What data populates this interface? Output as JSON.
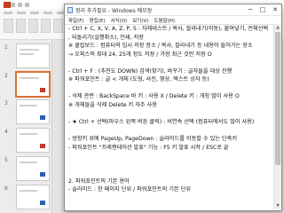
{
  "notepad": {
    "title": "정리 추가필요 - Windows 메모장",
    "menu": [
      "파일(F)",
      "편집(E)",
      "서식(O)",
      "보기(V)",
      "도움말(H)"
    ],
    "window_buttons": {
      "minimize": "─",
      "maximize": "□",
      "close": "✕"
    },
    "lines": [
      "- Ctrl + C, X, V, A, Z, P, S : 자체테스트 / 복사, 잘라내기(이동), 붙여넣기, 전체선택",
      "                              , 되돌리기(실행취소), 인쇄, 저장",
      "※ 클립보드 : 컴퓨터의 임시 저장 장소 / 복사, 잘라내기 등 내용이 들어가는 장소",
      "  → 오피스의 최대 24, 25개 정도 저장 / 가장 최근 것만 저장 O",
      "",
      "- Ctrl + F : (추천도 DOWN) 검색(찾기), 바꾸기 : 글자들을 대상 진행",
      "※ 파워포인트 : 글 < 개체 (도형, 사진, 영상, 텍스트 상자 등)",
      "",
      "- 삭제 관련 : BackSpace 바 키 : 사용 X / Delete 키 : 개칭 많이 사용 O",
      "  ※ 개체들을 삭제 Delete 키 자주 사용",
      "",
      "- ★ Ctrl + 선택(마우스 왼쪽 버튼 클릭) : 비연속 선택 (컴퓨터에서도 많이 사용)",
      "",
      "- 방향키 위에 PageUp, PageDown : 슬라이드를 이동할 수 있는 단축키",
      "- 파워포인트 \"프레젠테이션 발표\" 기능 : F5 키 발표 시작 / ESC로 끝",
      "",
      "",
      "",
      "2. 파워포인트의 기본 용어",
      "  - 슬라이드 : 한 페이지 단위 / 파워포인트의 기본 단위",
      "",
      "",
      ""
    ]
  },
  "thumbnails": [
    {
      "number": "1",
      "selected": false
    },
    {
      "number": "2",
      "selected": true
    },
    {
      "number": "3",
      "selected": false
    },
    {
      "number": "4",
      "selected": false
    },
    {
      "number": "5",
      "selected": false
    },
    {
      "number": "6",
      "selected": false
    }
  ],
  "colors": {
    "accent": "#c43e1c",
    "selection": "#d9732f",
    "shape_blue": "#2b5fb6",
    "shape_red": "#c0392b"
  }
}
